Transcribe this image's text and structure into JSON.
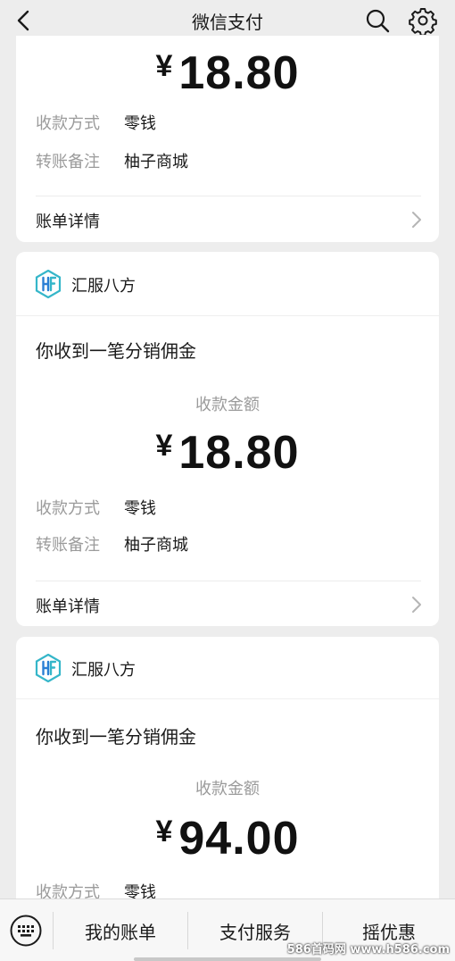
{
  "header": {
    "title": "微信支付"
  },
  "cards": [
    {
      "amount_currency": "¥",
      "amount_value": "18.80",
      "rows": [
        {
          "key": "收款方式",
          "value": "零钱"
        },
        {
          "key": "转账备注",
          "value": "柚子商城"
        }
      ],
      "detail_label": "账单详情"
    },
    {
      "merchant_name": "汇服八方",
      "headline": "你收到一笔分销佣金",
      "amount_label": "收款金额",
      "amount_currency": "¥",
      "amount_value": "18.80",
      "rows": [
        {
          "key": "收款方式",
          "value": "零钱"
        },
        {
          "key": "转账备注",
          "value": "柚子商城"
        }
      ],
      "detail_label": "账单详情"
    },
    {
      "merchant_name": "汇服八方",
      "headline": "你收到一笔分销佣金",
      "amount_label": "收款金额",
      "amount_currency": "¥",
      "amount_value": "94.00",
      "rows": [
        {
          "key": "收款方式",
          "value": "零钱"
        }
      ]
    }
  ],
  "bottom_bar": {
    "tabs": [
      "我的账单",
      "支付服务",
      "摇优惠"
    ]
  },
  "watermark": "586首码网 www.h586.com",
  "colors": {
    "logo_blue": "#2a7fd4",
    "logo_teal": "#35b6c9",
    "page_bg": "#ededed"
  }
}
